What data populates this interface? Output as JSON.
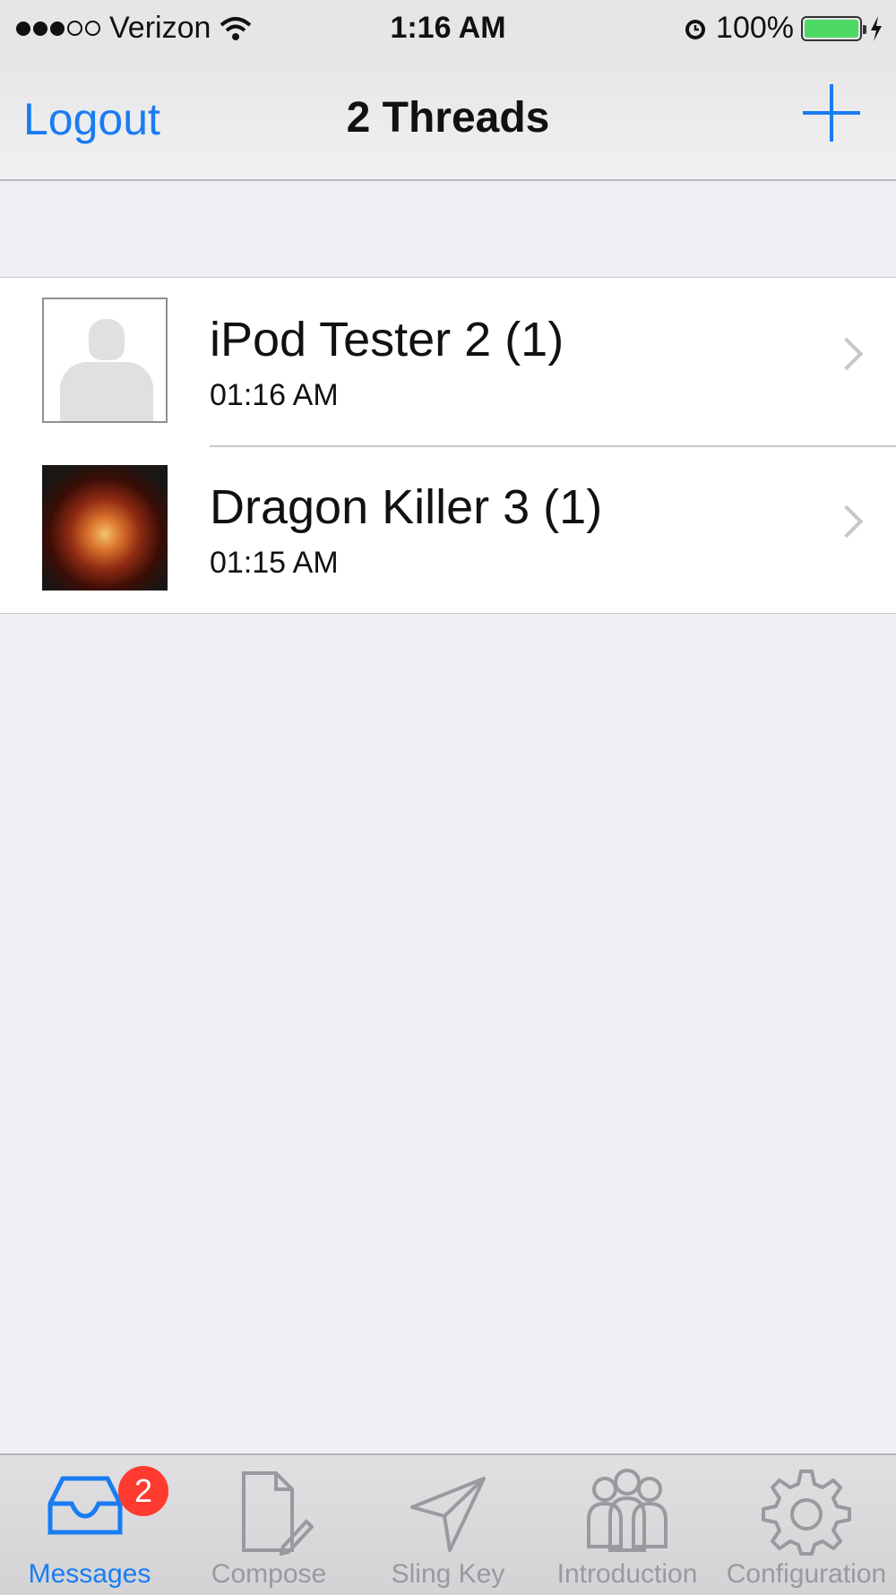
{
  "status": {
    "carrier": "Verizon",
    "time": "1:16 AM",
    "battery": "100%",
    "signal_bars": 3,
    "signal_total": 5
  },
  "nav": {
    "left_label": "Logout",
    "title": "2 Threads",
    "right_icon": "plus-icon"
  },
  "threads": [
    {
      "name": "iPod Tester 2 (1)",
      "time": "01:16 AM",
      "avatar": "placeholder-avatar"
    },
    {
      "name": "Dragon Killer 3 (1)",
      "time": "01:15 AM",
      "avatar": "dragon-avatar"
    }
  ],
  "tabs": [
    {
      "label": "Messages",
      "icon": "inbox-icon",
      "badge": "2",
      "active": true
    },
    {
      "label": "Compose",
      "icon": "compose-icon"
    },
    {
      "label": "Sling Key",
      "icon": "send-icon"
    },
    {
      "label": "Introduction",
      "icon": "people-icon"
    },
    {
      "label": "Configuration",
      "icon": "gear-icon"
    }
  ],
  "colors": {
    "accent": "#1a7cf2",
    "badge": "#ff3b30",
    "battery": "#4cd964"
  }
}
